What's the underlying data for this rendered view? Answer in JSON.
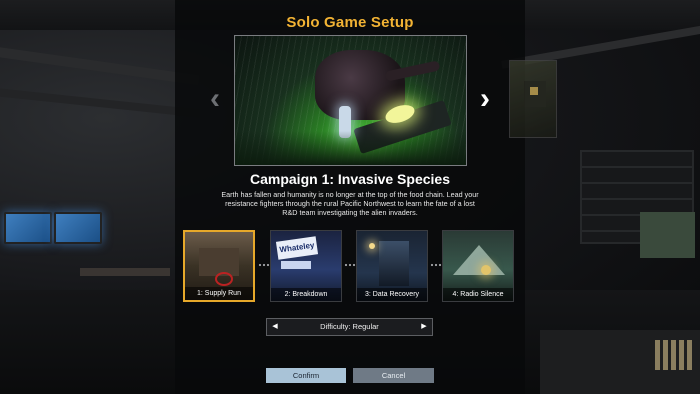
{
  "screen": {
    "title": "Solo Game Setup"
  },
  "campaign": {
    "title": "Campaign 1: Invasive Species",
    "description": "Earth has fallen and humanity is no longer at the top of the food chain. Lead your resistance fighters through the rural Pacific Northwest to learn the fate of a lost R&D team investigating the alien invaders.",
    "prev_arrow": "‹",
    "next_arrow": "›"
  },
  "missions": [
    {
      "label": "1: Supply Run",
      "selected": true
    },
    {
      "label": "2: Breakdown",
      "selected": false,
      "sign_text": "Whateley"
    },
    {
      "label": "3: Data Recovery",
      "selected": false
    },
    {
      "label": "4: Radio Silence",
      "selected": false
    }
  ],
  "difficulty": {
    "label": "Difficulty: Regular",
    "left_arrow": "◀",
    "right_arrow": "▶"
  },
  "buttons": {
    "confirm": "Confirm",
    "cancel": "Cancel"
  },
  "colors": {
    "title": "#f2b334",
    "selected_border": "#e6a82a",
    "confirm_bg": "#a9c3d7",
    "cancel_bg": "#6f7a86"
  }
}
